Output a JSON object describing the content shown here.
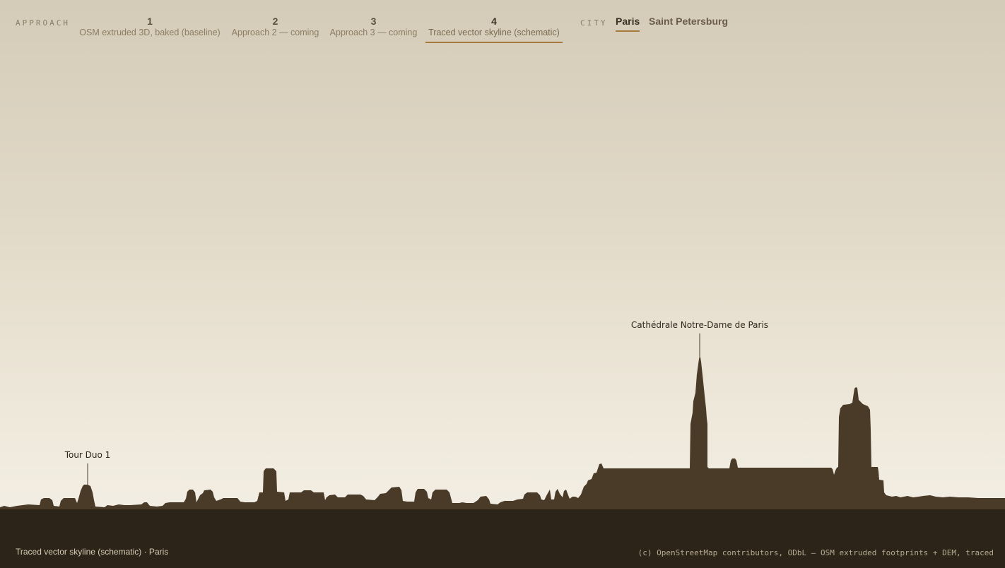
{
  "header": {
    "approach_label": "APPROACH",
    "tabs": [
      {
        "number": "1",
        "label": "OSM extruded 3D, baked (baseline)",
        "active": false
      },
      {
        "number": "2",
        "label": "Approach 2 — coming",
        "active": false
      },
      {
        "number": "3",
        "label": "Approach 3 — coming",
        "active": false
      },
      {
        "number": "4",
        "label": "Traced vector skyline (schematic)",
        "active": true
      }
    ],
    "city_label": "CITY",
    "cities": [
      {
        "label": "Paris",
        "active": true
      },
      {
        "label": "Saint Petersburg",
        "active": false
      }
    ]
  },
  "landmarks": [
    {
      "label": "Tour Duo 1"
    },
    {
      "label": "Cathédrale Notre-Dame de Paris"
    }
  ],
  "footer": {
    "caption": "Traced vector skyline (schematic) · Paris",
    "attribution": "(c) OpenStreetMap contributors, ODbL — OSM extruded footprints + DEM, traced"
  },
  "colors": {
    "accent": "#a57a3e",
    "silhouette": "#4a3b29",
    "ground": "#2c2419",
    "sky_top": "#d4cbb8",
    "sky_bottom": "#f5f1e8"
  }
}
